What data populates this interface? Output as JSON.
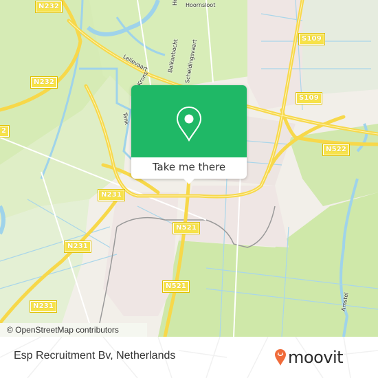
{
  "map": {
    "road_labels": [
      {
        "id": "n232-top",
        "text": "N232"
      },
      {
        "id": "n232-left",
        "text": "N232"
      },
      {
        "id": "n232-edge",
        "text": "2"
      },
      {
        "id": "n231-mid",
        "text": "N231"
      },
      {
        "id": "n231-lower",
        "text": "N231"
      },
      {
        "id": "n231-bottom",
        "text": "N231"
      },
      {
        "id": "n521-upper",
        "text": "N521"
      },
      {
        "id": "n521-lower",
        "text": "N521"
      },
      {
        "id": "s109-top",
        "text": "S109"
      },
      {
        "id": "s109-lower",
        "text": "S109"
      },
      {
        "id": "n522",
        "text": "N522"
      }
    ],
    "street_labels": {
      "hoornsloot": "Hoornsloot",
      "heuvel": "Heuvel",
      "lelievaart": "Lelievaart",
      "balkanbocht": "Balkanbocht",
      "scheidingsvaart": "Scheidingsvaart",
      "krons": "Krons",
      "tank": "Tank",
      "amstel": "Amstel"
    },
    "attribution": "© OpenStreetMap contributors",
    "colors": {
      "land": "#f2efe9",
      "green": "#cfe8a9",
      "water": "#9fd3ea",
      "motorway": "#f7e24a",
      "popup_green": "#1fb866"
    }
  },
  "popup": {
    "icon": "location-pin-icon",
    "action_label": "Take me there"
  },
  "footer": {
    "place_name": "Esp Recruitment Bv, Netherlands",
    "brand": "moovit",
    "brand_color": "#f06b3a"
  }
}
